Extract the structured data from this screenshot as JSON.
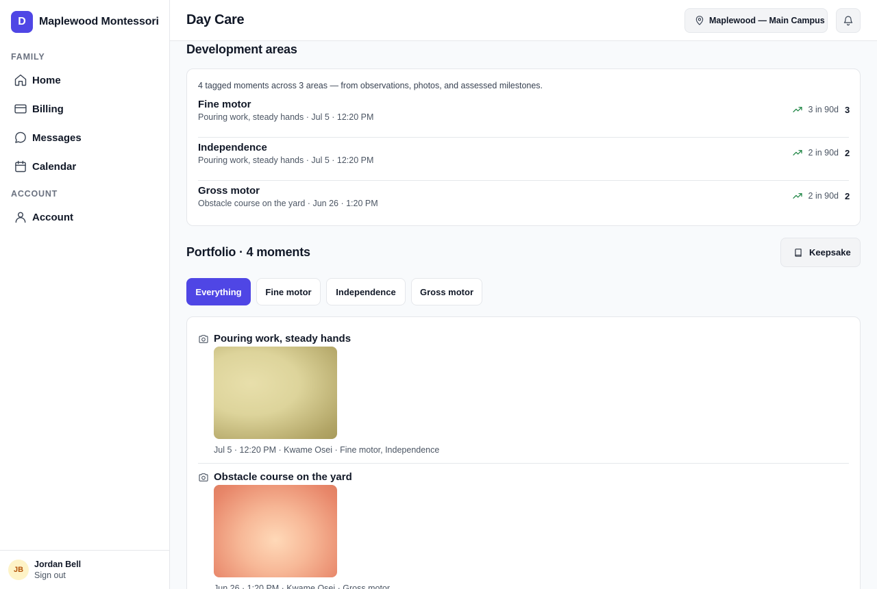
{
  "app": {
    "brand_initial": "D",
    "brand_name": "Maplewood Montessori",
    "brand_color": "#4f46e5"
  },
  "sidebar": {
    "family_label": "FAMILY",
    "account_label": "ACCOUNT",
    "items": [
      {
        "label": "Home",
        "icon": "home-icon"
      },
      {
        "label": "Billing",
        "icon": "credit-card-icon"
      },
      {
        "label": "Messages",
        "icon": "message-icon"
      },
      {
        "label": "Calendar",
        "icon": "calendar-icon"
      },
      {
        "label": "Account",
        "icon": "user-icon"
      }
    ],
    "user": {
      "initials": "JB",
      "name": "Jordan Bell",
      "signout": "Sign out"
    }
  },
  "header": {
    "title": "Day Care",
    "campus": "Maplewood — Main Campus"
  },
  "development": {
    "heading": "Development areas",
    "summary": "4 tagged moments across 3 areas — from observations, photos, and assessed milestones.",
    "trend_color": "#15803d",
    "areas": [
      {
        "name": "Fine motor",
        "latest": "Pouring work, steady hands · Jul 5 · 12:20 PM",
        "trend": "3 in 90d",
        "count": "3"
      },
      {
        "name": "Independence",
        "latest": "Pouring work, steady hands · Jul 5 · 12:20 PM",
        "trend": "2 in 90d",
        "count": "2"
      },
      {
        "name": "Gross motor",
        "latest": "Obstacle course on the yard · Jun 26 · 1:20 PM",
        "trend": "2 in 90d",
        "count": "2"
      }
    ]
  },
  "portfolio": {
    "heading": "Portfolio · 4 moments",
    "keepsake_label": "Keepsake",
    "filters": [
      "Everything",
      "Fine motor",
      "Independence",
      "Gross motor"
    ],
    "active_filter": "Everything",
    "moments": [
      {
        "title": "Pouring work, steady hands",
        "meta": "Jul 5 · 12:20 PM · Kwame Osei · Fine motor, Independence"
      },
      {
        "title": "Obstacle course on the yard",
        "meta": "Jun 26 · 1:20 PM · Kwame Osei · Gross motor"
      }
    ]
  }
}
